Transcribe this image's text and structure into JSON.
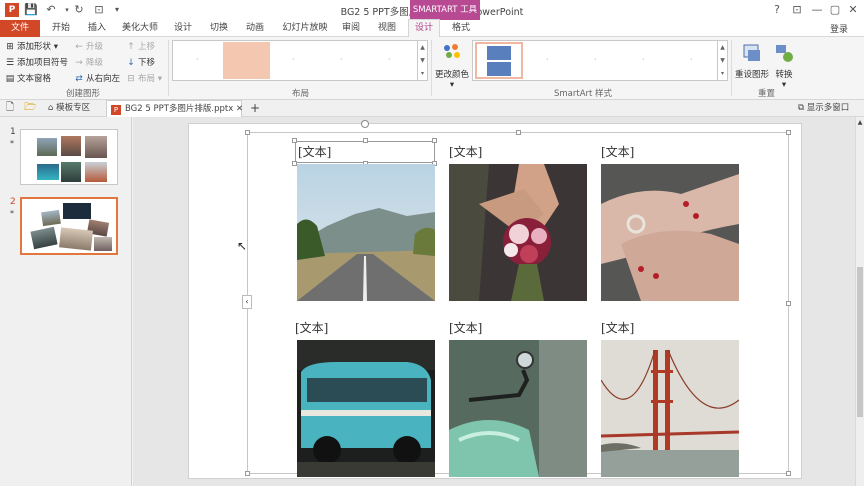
{
  "window": {
    "title": "BG2 5 PPT多图片排版.pptx - PowerPoint",
    "context_tab": "SMARTART 工具",
    "controls": [
      "?",
      "⊡",
      "—",
      "▢",
      "✕"
    ],
    "signin": "登录"
  },
  "tabs": [
    "文件",
    "开始",
    "插入",
    "美化大师",
    "设计",
    "切换",
    "动画",
    "幻灯片放映",
    "审阅",
    "视图",
    "设计",
    "格式"
  ],
  "ribbon": {
    "create_graphic": {
      "add_shape": "添加形状",
      "add_bullet": "添加项目符号",
      "text_pane": "文本窗格",
      "promote": "升级",
      "demote": "降级",
      "right_to_left": "从右向左",
      "move_up": "上移",
      "move_down": "下移",
      "layout": "布局",
      "label": "创建图形"
    },
    "layouts_label": "布局",
    "change_colors": "更改颜色",
    "styles_label": "SmartArt 样式",
    "reset_graphic": "重设图形",
    "convert": "转换",
    "reset_label": "重置"
  },
  "doc_tabs": {
    "template": "模板专区",
    "file": "BG2 5 PPT多图片排版.pptx",
    "add": "+",
    "multi_window": "显示多窗口"
  },
  "slides": [
    {
      "number": "1",
      "star": "*"
    },
    {
      "number": "2",
      "star": "*"
    }
  ],
  "placeholders": [
    "[文本]",
    "[文本]",
    "[文本]",
    "[文本]",
    "[文本]",
    "[文本]"
  ],
  "photos": [
    "road-photo",
    "bouquet-photo",
    "hands-ring-photo",
    "van-photo",
    "scooter-photo",
    "bridge-photo"
  ]
}
